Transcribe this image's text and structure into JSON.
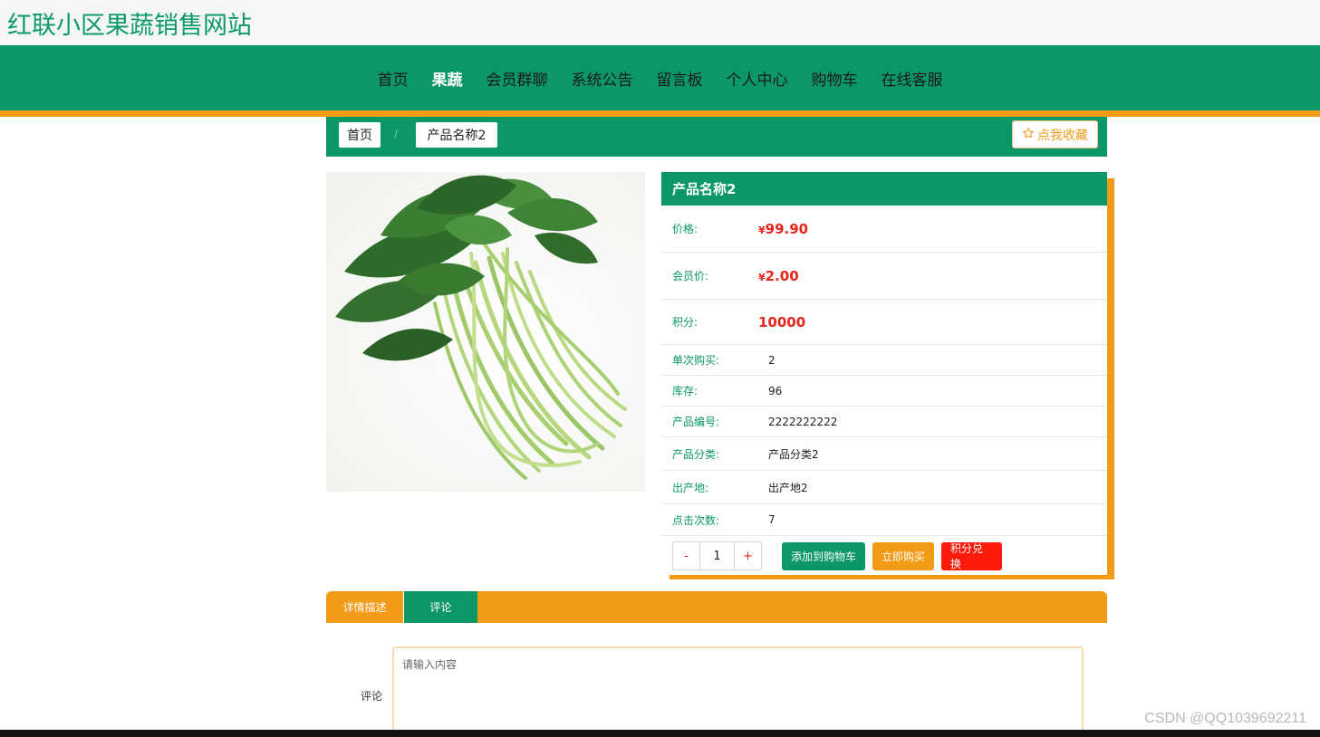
{
  "site": {
    "title": "红联小区果蔬销售网站"
  },
  "nav": {
    "items": [
      "首页",
      "果蔬",
      "会员群聊",
      "系统公告",
      "留言板",
      "个人中心",
      "购物车",
      "在线客服"
    ],
    "active_index": 1
  },
  "breadcrumb": {
    "home": "首页",
    "separator": "/",
    "current": "产品名称2"
  },
  "favorite": {
    "label": "点我收藏",
    "icon": "star-icon"
  },
  "product": {
    "name": "产品名称2",
    "price_label": "价格:",
    "price_currency": "¥",
    "price": "99.90",
    "member_price_label": "会员价:",
    "member_price": "2.00",
    "points_label": "积分:",
    "points": "10000",
    "single_purchase_label": "单次购买:",
    "single_purchase": "2",
    "stock_label": "库存:",
    "stock": "96",
    "code_label": "产品编号:",
    "code": "2222222222",
    "category_label": "产品分类:",
    "category": "产品分类2",
    "origin_label": "出产地:",
    "origin": "出产地2",
    "clicks_label": "点击次数:",
    "clicks": "7"
  },
  "quantity": {
    "minus": "-",
    "value": "1",
    "plus": "+"
  },
  "actions": {
    "add_to_cart": "添加到购物车",
    "buy_now": "立即购买",
    "points_exchange": "积分兑换"
  },
  "tabs": {
    "description": "详情描述",
    "comment": "评论"
  },
  "comment_form": {
    "label": "评论",
    "placeholder": "请输入内容"
  },
  "watermark": "CSDN @QQ1039692211",
  "colors": {
    "primary_green": "#0b9766",
    "accent_orange": "#f39a16",
    "price_red": "#e8251c",
    "exchange_red": "#ff1a0a"
  }
}
